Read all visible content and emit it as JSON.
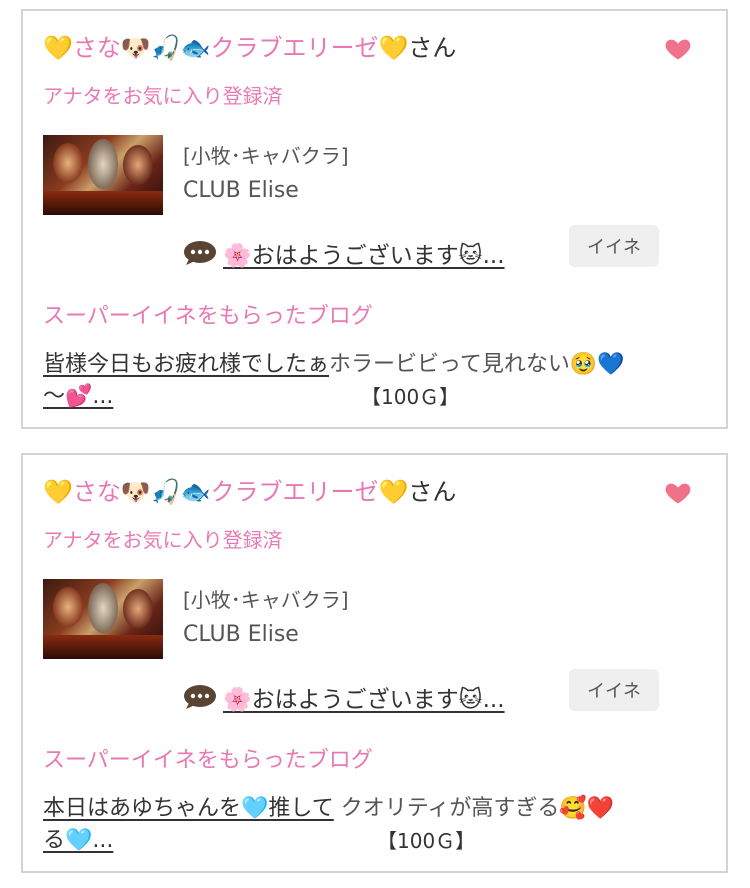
{
  "cards": [
    {
      "name_prefix": "💛さな🐶🎣🐟クラブエリーゼ💛",
      "name_suffix": "さん",
      "favorite_status": "アナタをお気に入り登録済",
      "category": "[小牧･キャバクラ]",
      "shop_name": "CLUB Elise",
      "message": "🌸おはようございます🐱...",
      "iine_label": "イイネ",
      "blog_heading": "スーパーイイネをもらったブログ",
      "blog_title_part1": "皆様今日もお疲れ様でしたぁ",
      "blog_excerpt": "ホラービビって見れない🥹💙",
      "blog_title_part2": "〜💕...",
      "blog_price": "【100Ｇ】"
    },
    {
      "name_prefix": "💛さな🐶🎣🐟クラブエリーゼ💛",
      "name_suffix": "さん",
      "favorite_status": "アナタをお気に入り登録済",
      "category": "[小牧･キャバクラ]",
      "shop_name": "CLUB Elise",
      "message": "🌸おはようございます🐱...",
      "iine_label": "イイネ",
      "blog_heading": "スーパーイイネをもらったブログ",
      "blog_title_part1": "本日はあゆちゃんを🩵推して",
      "blog_excerpt": "クオリティが高すぎる🥰❤️",
      "blog_title_part2": "る🩵...",
      "blog_price": "【100Ｇ】"
    }
  ],
  "colors": {
    "accent_pink": "#e879b5",
    "heart": "#f0728a",
    "border": "#d3d3d3",
    "button_bg": "#efefef"
  },
  "icons": {
    "favorite": "heart-icon",
    "message": "speech-bubble-icon"
  }
}
